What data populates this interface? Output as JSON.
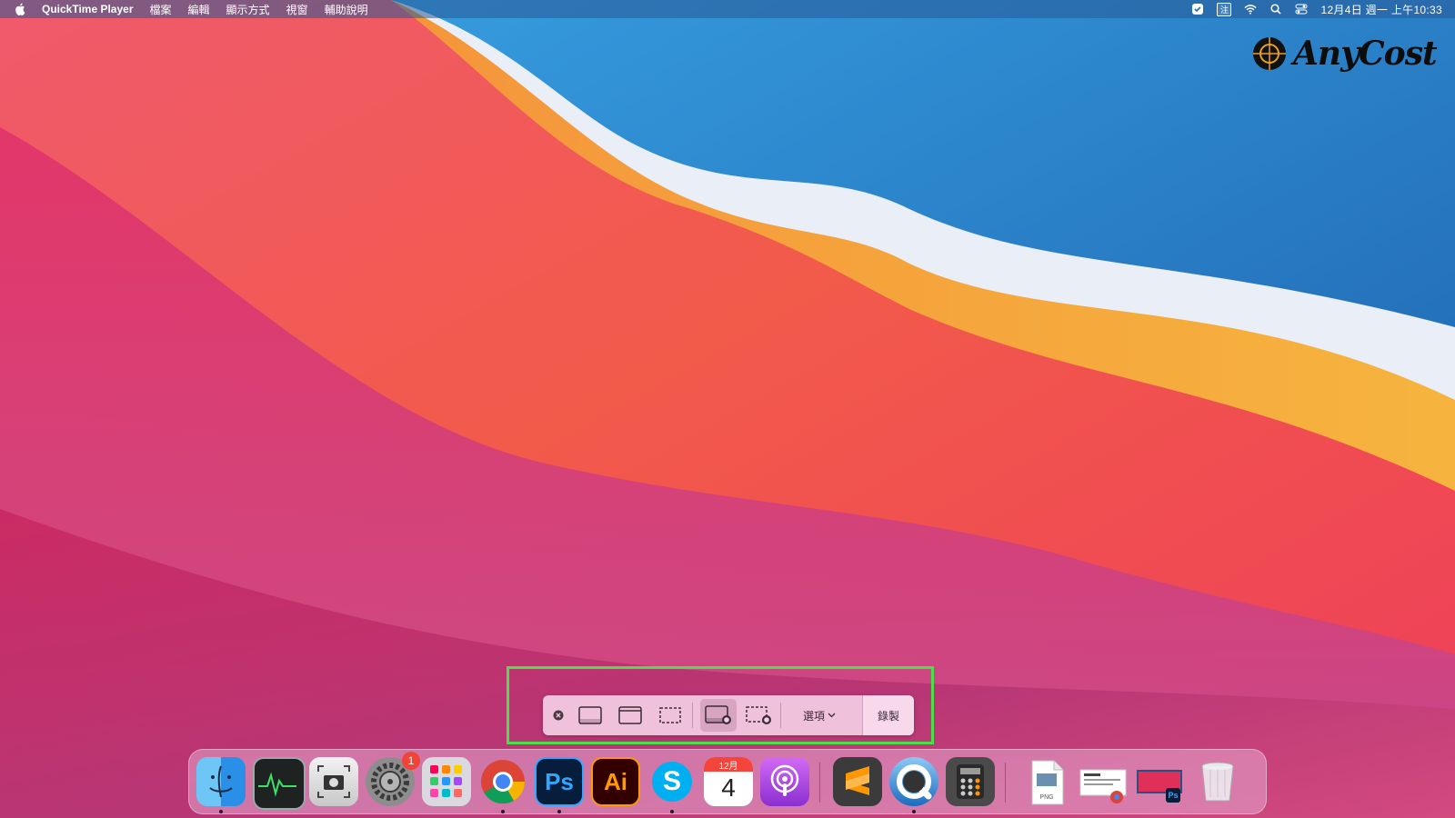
{
  "menubar": {
    "app_name": "QuickTime Player",
    "menus": [
      "檔案",
      "編輯",
      "顯示方式",
      "視窗",
      "輔助說明"
    ],
    "ime_label": "注",
    "clock": "12月4日 週一 上午10:33"
  },
  "watermark": {
    "text": "AnyCost"
  },
  "capture_toolbar": {
    "options_label": "選項",
    "record_label": "錄製",
    "selected_mode": "record-entire-screen"
  },
  "dock": {
    "apps": [
      {
        "id": "finder",
        "running": true
      },
      {
        "id": "activity-monitor",
        "running": false
      },
      {
        "id": "screenshot",
        "running": false
      },
      {
        "id": "system-preferences",
        "running": false,
        "badge": "1"
      },
      {
        "id": "launchpad",
        "running": false
      },
      {
        "id": "chrome",
        "running": true
      },
      {
        "id": "photoshop",
        "running": true,
        "label": "Ps"
      },
      {
        "id": "illustrator",
        "running": false,
        "label": "Ai"
      },
      {
        "id": "skype",
        "running": true,
        "label": "S"
      },
      {
        "id": "calendar",
        "running": false,
        "month": "12月",
        "day": "4"
      },
      {
        "id": "podcasts",
        "running": false
      }
    ],
    "apps2": [
      {
        "id": "sublime-text",
        "running": false
      },
      {
        "id": "quicktime",
        "running": true
      },
      {
        "id": "calculator",
        "running": false
      }
    ],
    "docs": [
      {
        "id": "png-file",
        "label": "PNG"
      },
      {
        "id": "chrome-document"
      },
      {
        "id": "photoshop-document",
        "label": "Ps"
      },
      {
        "id": "trash"
      }
    ]
  },
  "colors": {
    "highlight": "#4be04a",
    "toolbar_bg": "#f4cde4",
    "badge": "#f0443a"
  }
}
